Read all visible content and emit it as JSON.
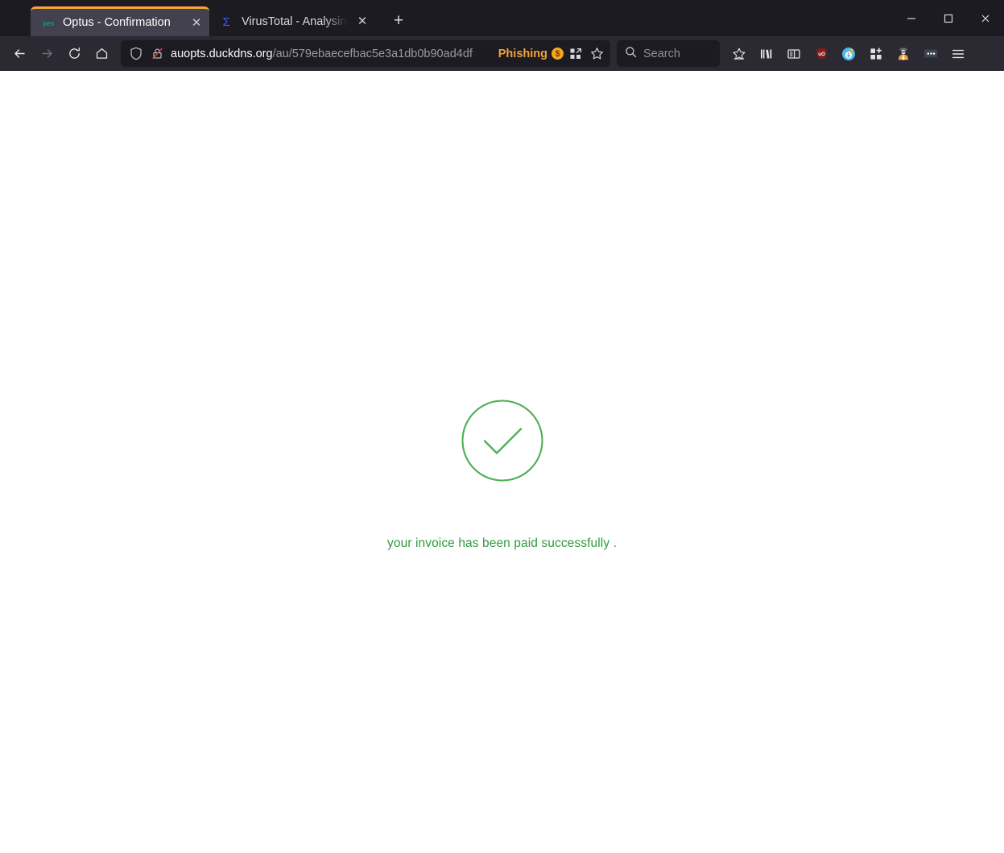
{
  "window": {
    "controls": [
      {
        "name": "minimize",
        "glyph": "—"
      },
      {
        "name": "maximize",
        "glyph": "□"
      },
      {
        "name": "close",
        "glyph": "✕"
      }
    ]
  },
  "tabs": [
    {
      "title": "Optus - Confirmation",
      "favicon": "optus-yes-logo-icon",
      "favicon_text": "yes",
      "active": true,
      "close_label": "✕",
      "container_color": "#f7a334"
    },
    {
      "title": "VirusTotal - Analysing URL",
      "favicon": "virustotal-sigma-icon",
      "favicon_text": "Σ",
      "active": false,
      "close_label": "✕",
      "container_color": ""
    }
  ],
  "new_tab": {
    "label": "+",
    "tooltip": "New tab"
  },
  "navigation": {
    "back": {
      "icon": "back-arrow-icon",
      "enabled": true
    },
    "forward": {
      "icon": "forward-arrow-icon",
      "enabled": false
    },
    "reload": {
      "icon": "reload-icon",
      "enabled": true
    },
    "home": {
      "icon": "home-icon",
      "enabled": true
    }
  },
  "urlbar": {
    "shield_icon": "tracking-protection-shield-icon",
    "lock_icon": "insecure-connection-crossed-lock-icon",
    "host": "auopts.duckdns.org",
    "path": "/au/579ebaecefbac5e3a1db0b90ad4df",
    "badge": {
      "label": "Phishing",
      "coin": "$",
      "color": "#f0a33a"
    },
    "pocket_icon": "page-actions-grid-icon",
    "bookmark_icon": "bookmark-star-icon"
  },
  "search": {
    "icon": "search-icon",
    "placeholder": "Search"
  },
  "toolbar_icons": [
    {
      "name": "save-to-pocket-icon",
      "label": "Save to Pocket"
    },
    {
      "name": "library-icon",
      "label": "Library"
    },
    {
      "name": "sidebar-icon",
      "label": "Sidebars"
    },
    {
      "name": "ublock-origin-icon",
      "label": "uBlock Origin"
    },
    {
      "name": "extension-blue-circle-icon",
      "label": "Extension"
    },
    {
      "name": "extensions-add-icon",
      "label": "Extensions"
    },
    {
      "name": "privacy-spy-icon",
      "label": "Privacy extension"
    },
    {
      "name": "more-dots-badge-icon",
      "label": "More tools"
    },
    {
      "name": "app-menu-hamburger-icon",
      "label": "Open application menu"
    }
  ],
  "page": {
    "check_icon": "success-check-circle-icon",
    "message": "your invoice has been paid successfully .",
    "accent_circle_color": "#4CAF50",
    "text_color": "#2e9b3e",
    "background": "#ffffff"
  }
}
